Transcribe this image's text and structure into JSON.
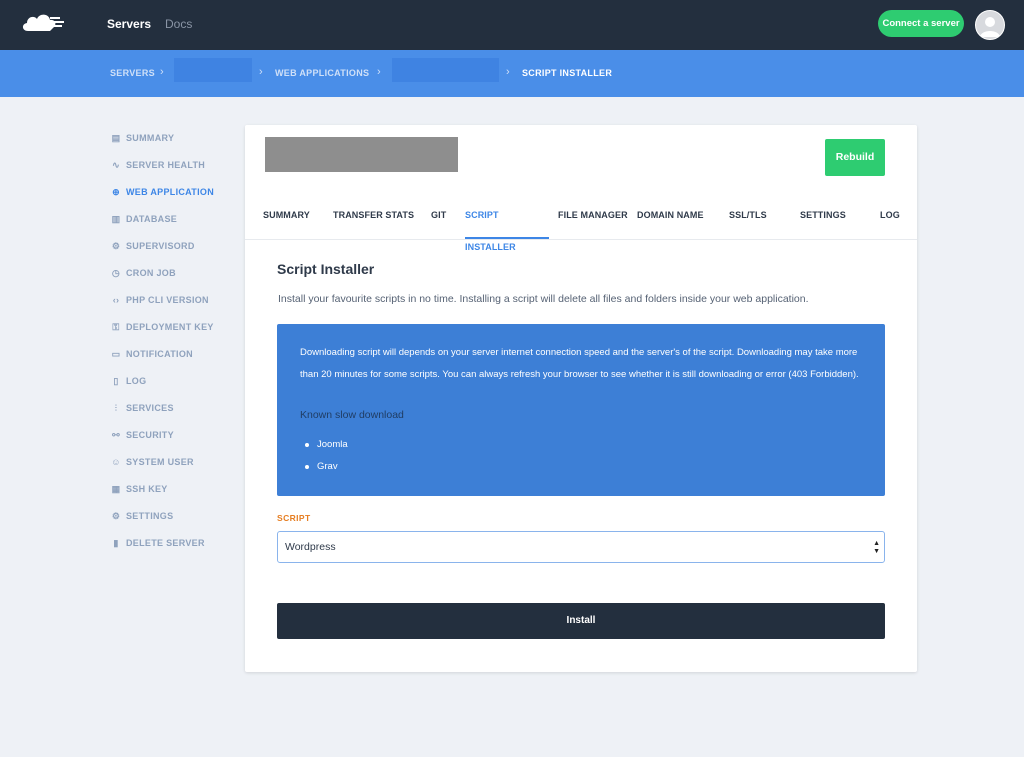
{
  "topbar": {
    "nav": [
      {
        "label": "Servers"
      },
      {
        "label": "Docs"
      }
    ],
    "connect_label": "Connect a server"
  },
  "breadcrumb": {
    "items": [
      "SERVERS",
      "WEB APPLICATIONS",
      "SCRIPT INSTALLER"
    ],
    "separator": "›"
  },
  "sidebar": {
    "items": [
      {
        "label": "SUMMARY",
        "icon": "file-icon",
        "glyph": "▤"
      },
      {
        "label": "SERVER HEALTH",
        "icon": "pulse-icon",
        "glyph": "∿"
      },
      {
        "label": "WEB APPLICATION",
        "icon": "globe-icon",
        "glyph": "⊕"
      },
      {
        "label": "DATABASE",
        "icon": "database-icon",
        "glyph": "▥"
      },
      {
        "label": "SUPERVISORD",
        "icon": "gear-icon",
        "glyph": "⚙"
      },
      {
        "label": "CRON JOB",
        "icon": "clock-icon",
        "glyph": "◷"
      },
      {
        "label": "PHP CLI VERSION",
        "icon": "code-icon",
        "glyph": "‹›"
      },
      {
        "label": "DEPLOYMENT KEY",
        "icon": "key-icon",
        "glyph": "⚿"
      },
      {
        "label": "NOTIFICATION",
        "icon": "monitor-icon",
        "glyph": "▭"
      },
      {
        "label": "LOG",
        "icon": "document-icon",
        "glyph": "▯"
      },
      {
        "label": "SERVICES",
        "icon": "sliders-icon",
        "glyph": "⫶"
      },
      {
        "label": "SECURITY",
        "icon": "link-icon",
        "glyph": "⚯"
      },
      {
        "label": "SYSTEM USER",
        "icon": "user-icon",
        "glyph": "☺"
      },
      {
        "label": "SSH KEY",
        "icon": "keyboard-icon",
        "glyph": "▦"
      },
      {
        "label": "SETTINGS",
        "icon": "settings-icon",
        "glyph": "⚙"
      },
      {
        "label": "DELETE SERVER",
        "icon": "trash-icon",
        "glyph": "▮"
      }
    ],
    "active_index": 2
  },
  "card": {
    "rebuild_label": "Rebuild",
    "tabs": [
      "SUMMARY",
      "TRANSFER STATS",
      "GIT",
      "SCRIPT INSTALLER",
      "FILE MANAGER",
      "DOMAIN NAME",
      "SSL/TLS",
      "SETTINGS",
      "LOG"
    ],
    "active_tab": "SCRIPT INSTALLER",
    "title": "Script Installer",
    "description": "Install your favourite scripts in no time. Installing a script will delete all files and folders inside your web application.",
    "info": {
      "text": "Downloading script will depends on your server internet connection speed and the server's of the script. Downloading may take more than 20 minutes for some scripts. You can always refresh your browser to see whether it is still downloading or error (403 Forbidden).",
      "known_label": "Known slow download",
      "known_items": [
        "Joomla",
        "Grav"
      ]
    },
    "script_label": "SCRIPT",
    "script_value": "Wordpress",
    "install_label": "Install"
  },
  "colors": {
    "topbar": "#232f3e",
    "breadcrumb_bar": "#4a8ee8",
    "accent_green": "#2ecc71",
    "info_box": "#3d7fd6",
    "active_blue": "#3d86e6",
    "script_label": "#e67e22"
  }
}
